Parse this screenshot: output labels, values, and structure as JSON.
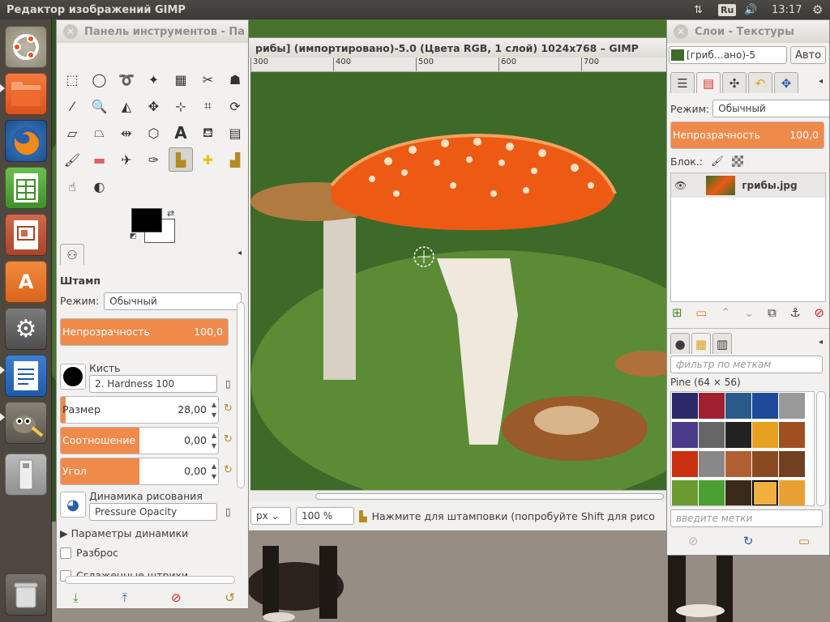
{
  "topbar": {
    "app_title": "Редактор изображений GIMP",
    "language": "Ru",
    "clock": "13:17"
  },
  "launcher": {
    "items": [
      {
        "name": "dash-home",
        "icon": "ubuntu-logo-icon"
      },
      {
        "name": "files",
        "icon": "folder-icon"
      },
      {
        "name": "firefox",
        "icon": "firefox-icon"
      },
      {
        "name": "libreoffice-calc",
        "icon": "spreadsheet-icon"
      },
      {
        "name": "libreoffice-impress",
        "icon": "presentation-icon"
      },
      {
        "name": "software-center",
        "icon": "software-center-icon"
      },
      {
        "name": "system-settings",
        "icon": "settings-icon"
      },
      {
        "name": "libreoffice-writer",
        "icon": "document-icon"
      },
      {
        "name": "gimp",
        "icon": "gimp-icon"
      },
      {
        "name": "usb-drive",
        "icon": "usb-icon"
      },
      {
        "name": "trash",
        "icon": "trash-icon"
      }
    ]
  },
  "image_window": {
    "title": "рибы] (импортировано)-5.0 (Цвета RGB, 1 слой) 1024x768 – GIMP",
    "ruler_ticks": [
      "300",
      "400",
      "500",
      "600",
      "700"
    ],
    "unit": "px",
    "zoom": "100 %",
    "status": "Нажмите для штамповки (попробуйте Shift для рисо"
  },
  "toolbox": {
    "title": "Панель инструментов - Па",
    "tool_options_title": "Штамп",
    "mode_label": "Режим:",
    "mode_value": "Обычный",
    "opacity": {
      "label": "Непрозрачность",
      "value": "100,0",
      "fill": 1.0
    },
    "brush_label": "Кисть",
    "brush_value": "2. Hardness 100",
    "size": {
      "label": "Размер",
      "value": "28,00",
      "fill": 0.03
    },
    "aspect": {
      "label": "Соотношение сторон",
      "value": "0,00",
      "fill": 0.5
    },
    "angle": {
      "label": "Угол",
      "value": "0,00",
      "fill": 0.5
    },
    "dynamics_label": "Динамика рисования",
    "dynamics_value": "Pressure Opacity",
    "dynamics_options": "Параметры динамики",
    "jitter": "Разброс",
    "smooth": "Сглаженные штрихи"
  },
  "layers": {
    "title": "Слои - Текстуры",
    "image_combo": "[гриб…ано)-5",
    "auto_button": "Авто",
    "mode_label": "Режим:",
    "mode_value": "Обычный",
    "opacity": {
      "label": "Непрозрачность",
      "value": "100,0",
      "fill": 1.0
    },
    "lock_label": "Блок.:",
    "layer_name": "грибы.jpg",
    "filter_placeholder": "фильтр по меткам",
    "pattern_name": "Pine (64 × 56)",
    "tags_placeholder": "введите метки"
  },
  "colors": {
    "accent": "#f08a4b",
    "launcher_bg": "#3e3730",
    "topbar_bg": "#3c3b37",
    "dialog_bg": "#f2f1ef"
  }
}
